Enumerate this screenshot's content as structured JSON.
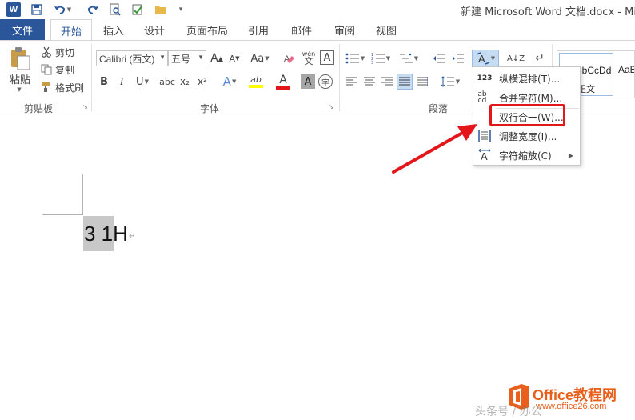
{
  "window": {
    "app_icon": "W",
    "title": "新建 Microsoft Word 文档.docx - Micr"
  },
  "tabs": {
    "file": "文件",
    "home": "开始",
    "insert": "插入",
    "design": "设计",
    "layout": "页面布局",
    "references": "引用",
    "mailings": "邮件",
    "review": "审阅",
    "view": "视图"
  },
  "clipboard": {
    "paste": "粘贴",
    "cut": "剪切",
    "copy": "复制",
    "format_painter": "格式刷",
    "group": "剪贴板"
  },
  "font": {
    "name": "Calibri (西文)",
    "size": "五号",
    "grow": "A",
    "shrink": "A",
    "case": "Aa",
    "phonetic": "wén",
    "char_border": "A",
    "bold": "B",
    "italic": "I",
    "underline": "U",
    "strike": "abc",
    "subscript": "x₂",
    "superscript": "x²",
    "effects": "A",
    "highlight": "ab",
    "color": "A",
    "shading": "A",
    "enclose": "字",
    "group": "字体"
  },
  "paragraph": {
    "group": "段落",
    "sort": "A↓Z",
    "marks": "↵"
  },
  "styles": {
    "normal_sample": "AaBbCcDd",
    "normal_name": "正文",
    "next_sample": "AaB"
  },
  "document": {
    "text": "3 1H",
    "para_mark": "↵"
  },
  "menu": {
    "items": [
      {
        "icon": "123",
        "label": "纵横混排(T)..."
      },
      {
        "icon": "ab cd",
        "label": "合并字符(M)..."
      },
      {
        "icon": "",
        "label": "双行合一(W)..."
      },
      {
        "icon": "",
        "label": "调整宽度(I)..."
      },
      {
        "icon": "",
        "label": "字符缩放(C)"
      }
    ],
    "highlight_color": "#e3171a"
  },
  "watermark": {
    "brand": "Office教程网",
    "url": "www.office26.com",
    "caption": "头条号 / 办公"
  },
  "colors": {
    "accent": "#2b579a",
    "highlight_yellow": "#ffff00",
    "font_red": "#e3171a",
    "watermark_orange": "#e8601c"
  }
}
